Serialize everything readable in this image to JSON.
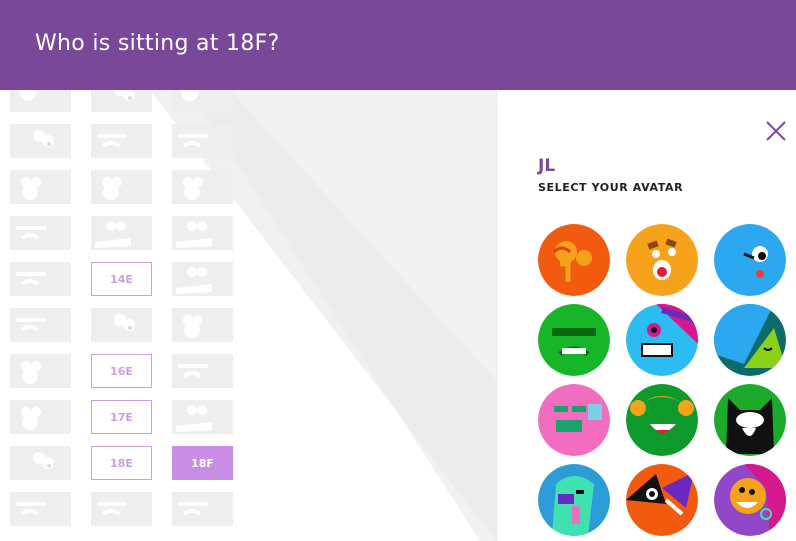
{
  "header": {
    "title": "Who is sitting at 18F?"
  },
  "seatmap": {
    "rows": [
      {
        "seats": [
          {
            "type": "face-a"
          },
          {
            "type": "face-c"
          },
          {
            "type": "face-a"
          }
        ]
      },
      {
        "seats": [
          {
            "type": "face-c"
          },
          {
            "type": "face-b"
          },
          {
            "type": "face-b"
          }
        ]
      },
      {
        "seats": [
          {
            "type": "face-d"
          },
          {
            "type": "face-d"
          },
          {
            "type": "face-d"
          }
        ]
      },
      {
        "seats": [
          {
            "type": "face-b"
          },
          {
            "type": "face-e"
          },
          {
            "type": "face-e"
          }
        ]
      },
      {
        "seats": [
          {
            "type": "face-b"
          },
          {
            "type": "empty",
            "label": "14E"
          },
          {
            "type": "face-e"
          }
        ]
      },
      {
        "seats": [
          {
            "type": "face-b"
          },
          {
            "type": "face-c"
          },
          {
            "type": "face-d"
          }
        ]
      },
      {
        "seats": [
          {
            "type": "face-d"
          },
          {
            "type": "empty",
            "label": "16E"
          },
          {
            "type": "face-b"
          }
        ]
      },
      {
        "seats": [
          {
            "type": "face-d"
          },
          {
            "type": "empty",
            "label": "17E"
          },
          {
            "type": "face-e"
          }
        ]
      },
      {
        "seats": [
          {
            "type": "face-c"
          },
          {
            "type": "empty",
            "label": "18E"
          },
          {
            "type": "selected",
            "label": "18F"
          }
        ]
      },
      {
        "seats": [
          {
            "type": "face-b"
          },
          {
            "type": "face-b"
          },
          {
            "type": "face-b"
          }
        ]
      }
    ]
  },
  "panel": {
    "initials": "JL",
    "subtitle": "SELECT YOUR AVATAR",
    "close_icon": "close-icon",
    "avatars": [
      {
        "name": "orange-drooling",
        "color": "#f15a0f"
      },
      {
        "name": "yellow-tongue",
        "color": "#f7a21b"
      },
      {
        "name": "blue-wink",
        "color": "#2ba8f0"
      },
      {
        "name": "green-grumpy",
        "color": "#17b629"
      },
      {
        "name": "blue-teeth",
        "color": "#2bbcf2"
      },
      {
        "name": "teal-yellow-sleepy",
        "color": "#0d6b6b"
      },
      {
        "name": "pink-mustache",
        "color": "#f26dbf"
      },
      {
        "name": "green-blonde",
        "color": "#0d9a2b"
      },
      {
        "name": "black-cat",
        "color": "#1aab2a"
      },
      {
        "name": "mint-monster",
        "color": "#2b9cd7"
      },
      {
        "name": "orange-fox",
        "color": "#f15a0f"
      },
      {
        "name": "purple-hair",
        "color": "#9147c8"
      }
    ]
  },
  "colors": {
    "header": "#7a4898",
    "accent": "#c99fdc",
    "selected": "#c98de6"
  }
}
